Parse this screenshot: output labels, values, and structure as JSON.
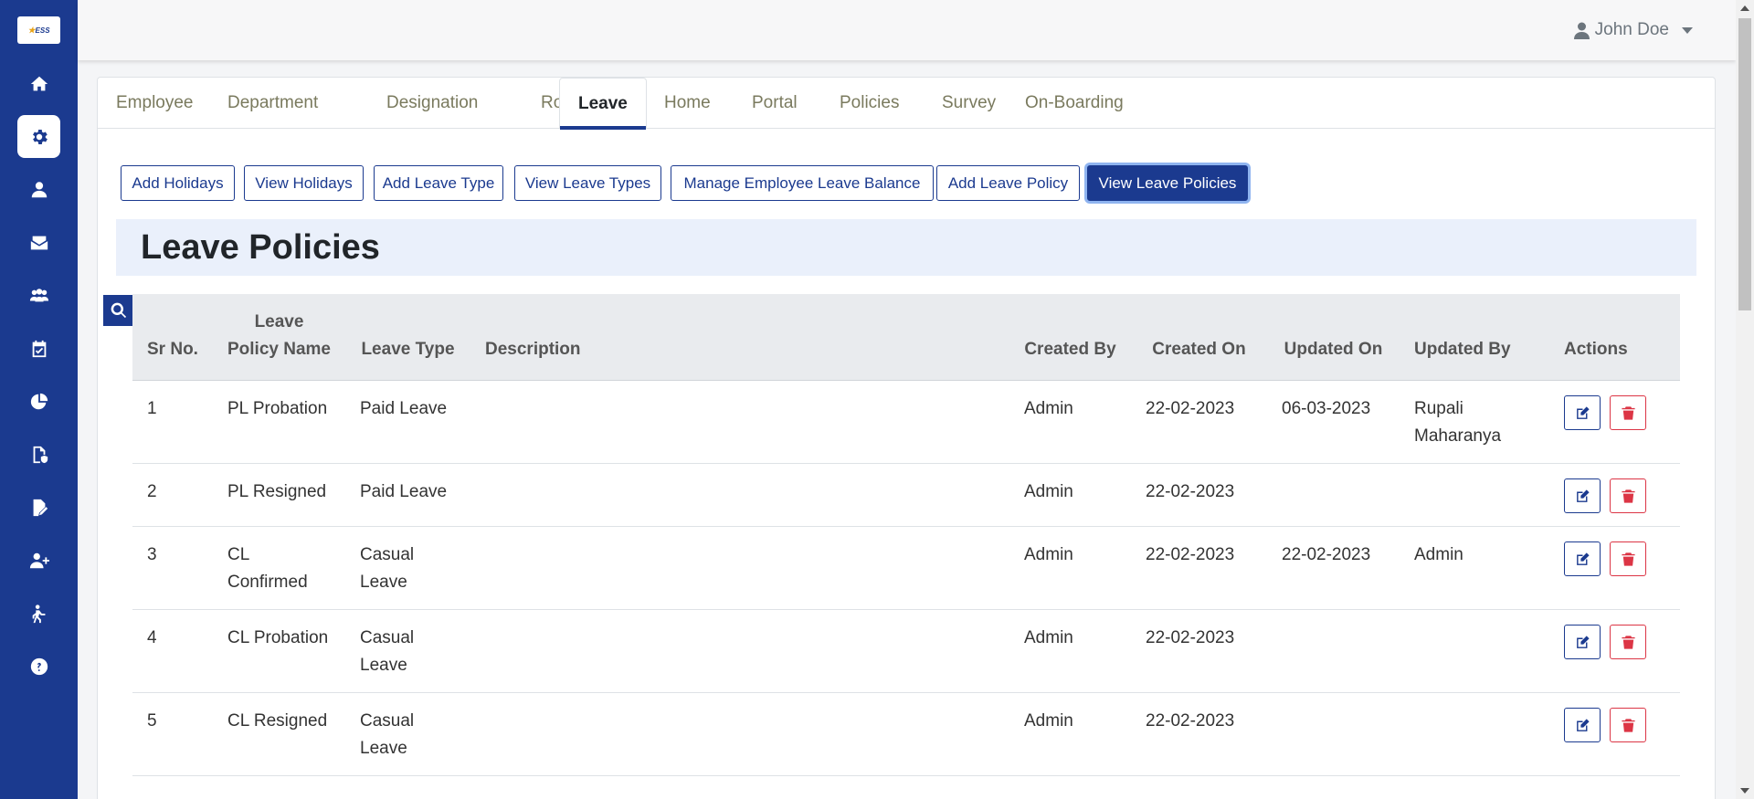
{
  "colors": {
    "primary": "#1b3a8f",
    "danger": "#dc3545",
    "title_band": "#eaf0fb"
  },
  "sidebar": {
    "logo_text": "ESS",
    "items": [
      {
        "icon": "home-icon"
      },
      {
        "icon": "gear-icon",
        "active": true
      },
      {
        "icon": "user-icon"
      },
      {
        "icon": "mail-inbox-icon"
      },
      {
        "icon": "users-group-icon"
      },
      {
        "icon": "calendar-check-icon"
      },
      {
        "icon": "pie-chart-icon"
      },
      {
        "icon": "file-shield-icon"
      },
      {
        "icon": "file-signature-icon"
      },
      {
        "icon": "user-plus-icon"
      },
      {
        "icon": "person-exit-icon"
      },
      {
        "icon": "help-icon"
      }
    ]
  },
  "header": {
    "user_name": "John Doe"
  },
  "tabs": [
    {
      "label": "Employee"
    },
    {
      "label": "Department"
    },
    {
      "label": "Designation"
    },
    {
      "label": "Role"
    },
    {
      "label": "Leave",
      "active": true
    },
    {
      "label": "Home"
    },
    {
      "label": "Portal"
    },
    {
      "label": "Policies"
    },
    {
      "label": "Survey"
    },
    {
      "label": "On-Boarding"
    }
  ],
  "actions": [
    {
      "label": "Add Holidays"
    },
    {
      "label": "View Holidays"
    },
    {
      "label": "Add Leave Type"
    },
    {
      "label": "View Leave Types"
    },
    {
      "label": "Manage Employee Leave Balance"
    },
    {
      "label": "Add Leave Policy"
    },
    {
      "label": "View Leave Policies",
      "active": true
    }
  ],
  "page_title": "Leave Policies",
  "table": {
    "headers": {
      "sr_no": "Sr No.",
      "policy_name": "Leave Policy Name",
      "leave_type": "Leave Type",
      "description": "Description",
      "created_by": "Created By",
      "created_on": "Created On",
      "updated_on": "Updated On",
      "updated_by": "Updated By",
      "actions": "Actions"
    },
    "rows": [
      {
        "sr": "1",
        "name": "PL Probation",
        "type": "Paid Leave",
        "desc": "",
        "created_by": "Admin",
        "created_on": "22-02-2023",
        "updated_on": "06-03-2023",
        "updated_by": "Rupali Maharanya"
      },
      {
        "sr": "2",
        "name": "PL Resigned",
        "type": "Paid Leave",
        "desc": "",
        "created_by": "Admin",
        "created_on": "22-02-2023",
        "updated_on": "",
        "updated_by": ""
      },
      {
        "sr": "3",
        "name": "CL Confirmed",
        "type": "Casual Leave",
        "desc": "",
        "created_by": "Admin",
        "created_on": "22-02-2023",
        "updated_on": "22-02-2023",
        "updated_by": "Admin"
      },
      {
        "sr": "4",
        "name": "CL Probation",
        "type": "Casual Leave",
        "desc": "",
        "created_by": "Admin",
        "created_on": "22-02-2023",
        "updated_on": "",
        "updated_by": ""
      },
      {
        "sr": "5",
        "name": "CL Resigned",
        "type": "Casual Leave",
        "desc": "",
        "created_by": "Admin",
        "created_on": "22-02-2023",
        "updated_on": "",
        "updated_by": ""
      }
    ]
  }
}
